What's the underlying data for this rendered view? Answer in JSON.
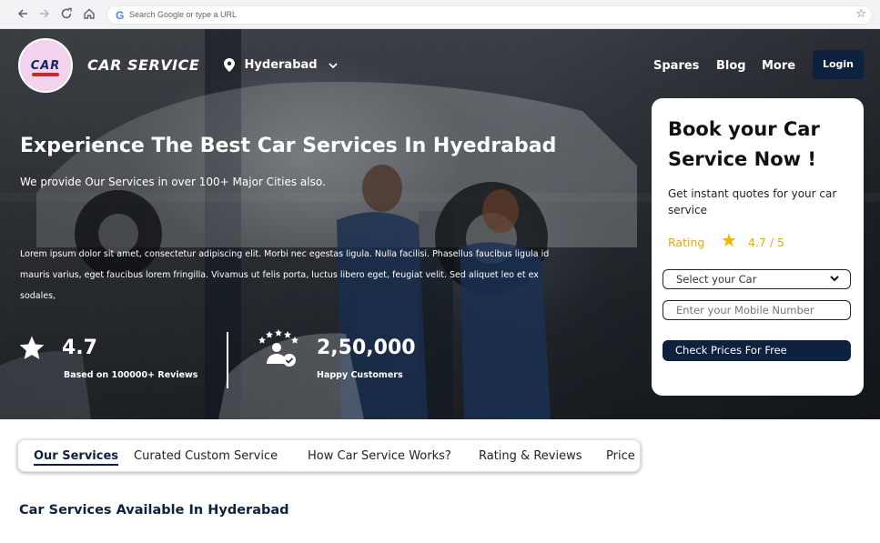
{
  "browser": {
    "omnibox_placeholder": "Search Google or type a URL",
    "icons": [
      "back-arrow-icon",
      "forward-arrow-icon",
      "reload-icon",
      "home-icon",
      "google-icon",
      "bookmark-star-icon"
    ]
  },
  "header": {
    "logo_text": "CAR",
    "brand": "CAR SERVICE",
    "location": "Hyderabad",
    "nav": [
      "Spares",
      "Blog",
      "More"
    ],
    "login_label": "Login"
  },
  "hero": {
    "title": "Experience The Best Car Services In Hyedrabad",
    "subtitle": "We provide Our Services in over 100+ Major Cities also.",
    "body": "Lorem ipsum dolor sit amet, consectetur adipiscing elit. Morbi nec egestas ligula. Nulla facilisi. Phasellus faucibus ligula id mauris varius, eget faucibus lorem fringilla. Vivamus ut felis porta, luctus libero eget, feugiat velit. Sed aliquet leo et ex sodales,",
    "stats": [
      {
        "value": "4.7",
        "label": "Based on 100000+ Reviews",
        "icon": "star-icon"
      },
      {
        "value": "2,50,000",
        "label": "Happy Customers",
        "icon": "happy-customers-icon"
      }
    ]
  },
  "booking": {
    "title": "Book your Car Service Now !",
    "description": "Get instant quotes for your car service",
    "rating_label": "Rating",
    "rating_value": "4.7 / 5",
    "car_select": "Select your Car",
    "mobile_placeholder": "Enter your Mobile Number",
    "cta": "Check Prices For Free"
  },
  "tabs": [
    "Our Services",
    "Curated Custom Service",
    "How Car Service Works?",
    "Rating & Reviews",
    "Price"
  ],
  "active_tab": "Our Services",
  "section_title": "Car Services Available In Hyderabad",
  "colors": {
    "navy": "#0e213f",
    "rating_gold": "#e6a817",
    "logo_pink": "#f3d2ee"
  }
}
